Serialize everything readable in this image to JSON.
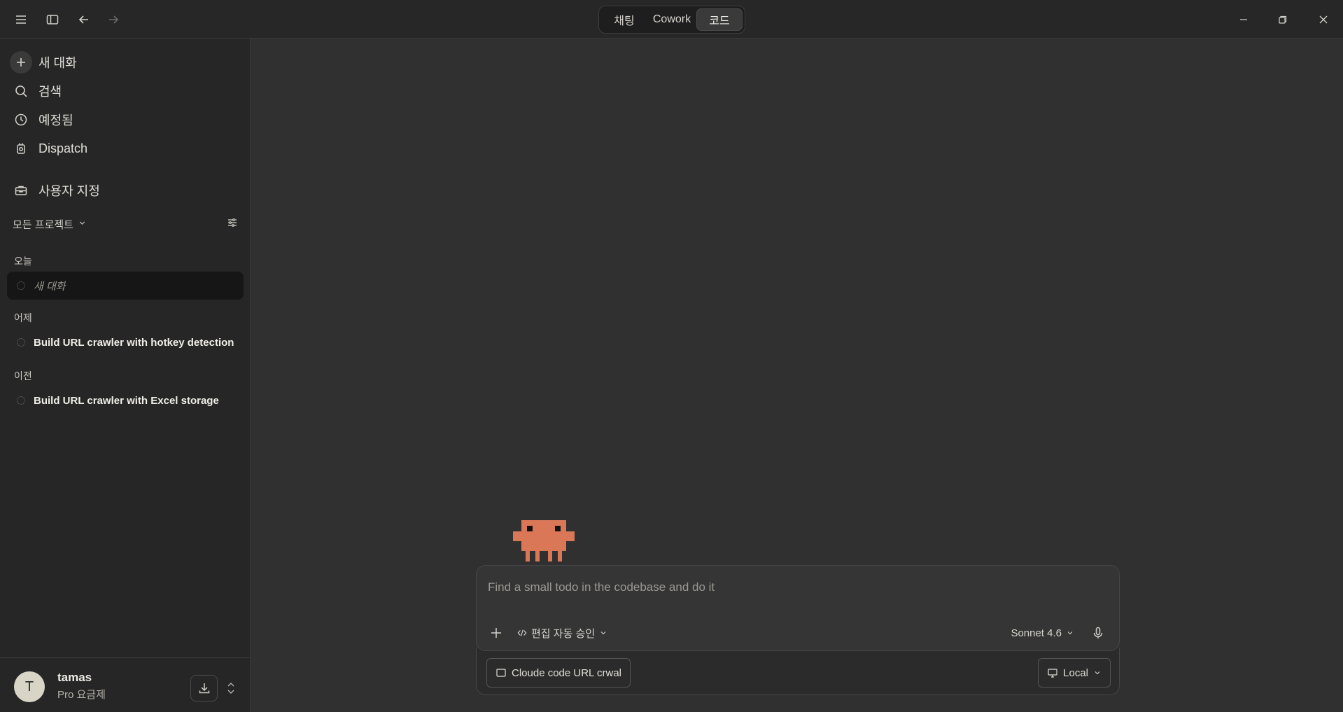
{
  "titlebar": {
    "mode_tabs": [
      {
        "label": "채팅",
        "active": false
      },
      {
        "label": "Cowork",
        "active": false
      },
      {
        "label": "코드",
        "active": true
      }
    ]
  },
  "sidebar": {
    "nav": [
      {
        "label": "새 대화",
        "icon": "plus-icon"
      },
      {
        "label": "검색",
        "icon": "search-icon"
      },
      {
        "label": "예정됨",
        "icon": "clock-icon"
      },
      {
        "label": "Dispatch",
        "icon": "dispatch-icon"
      },
      {
        "label": "사용자 지정",
        "icon": "briefcase-icon"
      }
    ],
    "projects_filter": "모든 프로젝트",
    "sections": [
      {
        "label": "오늘",
        "items": [
          {
            "label": "새 대화",
            "active": true
          }
        ]
      },
      {
        "label": "어제",
        "items": [
          {
            "label": "Build URL crawler with hotkey detection"
          }
        ]
      },
      {
        "label": "이전",
        "items": [
          {
            "label": "Build URL crawler with Excel storage"
          }
        ]
      }
    ],
    "user": {
      "initial": "T",
      "name": "tamas",
      "plan": "Pro 요금제"
    }
  },
  "composer": {
    "placeholder": "Find a small todo in the codebase and do it",
    "mode_label": "편집 자동 승인",
    "model_label": "Sonnet 4.6",
    "project_chip": "Cloude code URL crwal",
    "env_chip": "Local"
  },
  "colors": {
    "accent_mascot": "#d97757",
    "background": "#303030",
    "sidebar": "#262626"
  }
}
